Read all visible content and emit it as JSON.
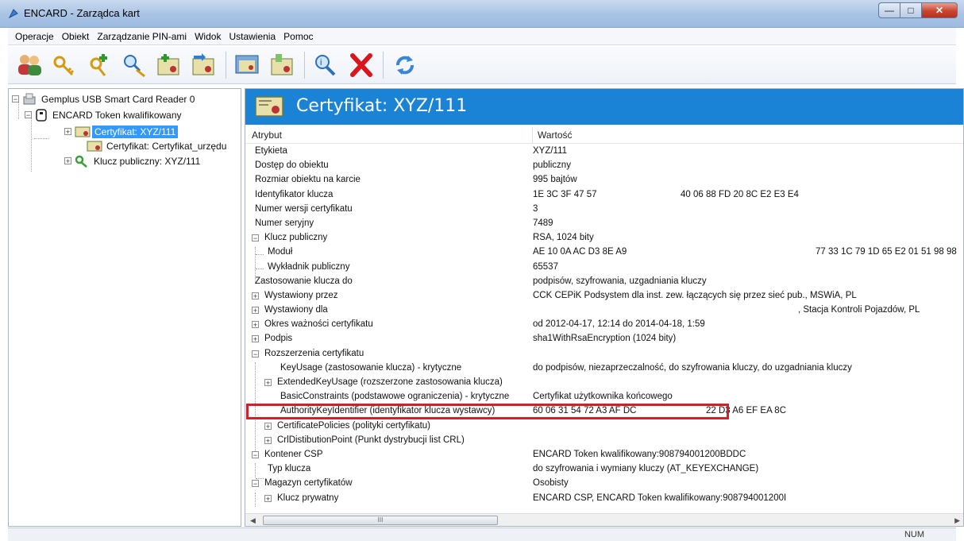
{
  "window": {
    "title": "ENCARD - Zarządca kart"
  },
  "menu": [
    "Operacje",
    "Obiekt",
    "Zarządzanie PIN-ami",
    "Widok",
    "Ustawienia",
    "Pomoc"
  ],
  "toolbar": {
    "buttons": [
      "users-icon",
      "key-search-icon",
      "key-add-icon",
      "search-key-icon",
      "cert-add-icon",
      "cert-export-icon",
      "cert-view-icon",
      "cert-import-icon",
      "help-icon",
      "delete-icon",
      "refresh-icon"
    ]
  },
  "tree": {
    "reader": "Gemplus USB Smart Card Reader 0",
    "token": "ENCARD Token kwalifikowany",
    "items": [
      "Certyfikat: XYZ/111",
      "Certyfikat: Certyfikat_urzędu",
      "Klucz publiczny: XYZ/111"
    ]
  },
  "detail": {
    "banner_title": "Certyfikat: XYZ/111",
    "col_attr": "Atrybut",
    "col_value": "Wartość",
    "rows": [
      {
        "attr": "Etykieta",
        "value": "XYZ/111"
      },
      {
        "attr": "Dostęp do obiektu",
        "value": "publiczny"
      },
      {
        "attr": "Rozmiar obiektu na karcie",
        "value": "995 bajtów"
      },
      {
        "attr": "Identyfikator klucza",
        "value": "1E 3C 3F 47 57",
        "value2": "40 06 88 FD 20 8C E2 E3 E4"
      },
      {
        "attr": "Numer wersji certyfikatu",
        "value": "3"
      },
      {
        "attr": "Numer seryjny",
        "value": "7489"
      },
      {
        "attr": "Klucz publiczny",
        "value": "RSA, 1024 bity"
      },
      {
        "attr": "Moduł",
        "value": "AE 10 0A AC D3 8E A9",
        "value2": "77 33 1C 79 1D 65 E2 01 51 98 98"
      },
      {
        "attr": "Wykładnik publiczny",
        "value": "65537"
      },
      {
        "attr": "Zastosowanie klucza do",
        "value": "podpisów, szyfrowania, uzgadniania kluczy"
      },
      {
        "attr": "Wystawiony przez",
        "value": "CCK CEPiK Podsystem dla inst. zew. łączących się przez sieć pub., MSWiA, PL"
      },
      {
        "attr": "Wystawiony dla",
        "value": "",
        "value2": ", Stacja Kontroli Pojazdów, PL"
      },
      {
        "attr": "Okres ważności certyfikatu",
        "value": "od 2012-04-17, 12:14 do 2014-04-18, 1:59"
      },
      {
        "attr": "Podpis",
        "value": "sha1WithRsaEncryption (1024 bity)"
      },
      {
        "attr": "Rozszerzenia certyfikatu",
        "value": ""
      },
      {
        "attr": "KeyUsage (zastosowanie klucza) - krytyczne",
        "value": "do podpisów, niezaprzeczalność, do szyfrowania kluczy, do uzgadniania kluczy"
      },
      {
        "attr": "ExtendedKeyUsage (rozszerzone zastosowania klucza)",
        "value": ""
      },
      {
        "attr": "BasicConstraints (podstawowe ograniczenia) - krytyczne",
        "value": "Certyfikat użytkownika końcowego"
      },
      {
        "attr": "AuthorityKeyIdentifier (identyfikator klucza wystawcy)",
        "value": "60 06 31 54 72 A3 AF DC",
        "value2": "22 D3 A6 EF EA 8C"
      },
      {
        "attr": "CertificatePolicies (polityki certyfikatu)",
        "value": ""
      },
      {
        "attr": "CrlDistibutionPoint (Punkt dystrybucji list CRL)",
        "value": ""
      },
      {
        "attr": "Kontener CSP",
        "value": "ENCARD Token kwalifikowany:908794001200BDDC"
      },
      {
        "attr": "Typ klucza",
        "value": "do szyfrowania i wymiany kluczy (AT_KEYEXCHANGE)"
      },
      {
        "attr": "Magazyn certyfikatów",
        "value": "Osobisty"
      },
      {
        "attr": "Klucz prywatny",
        "value": "ENCARD CSP, ENCARD Token kwalifikowany:908794001200I"
      }
    ]
  },
  "scrollbar": {
    "thumb_grip": "III"
  },
  "status": {
    "num": "NUM"
  }
}
